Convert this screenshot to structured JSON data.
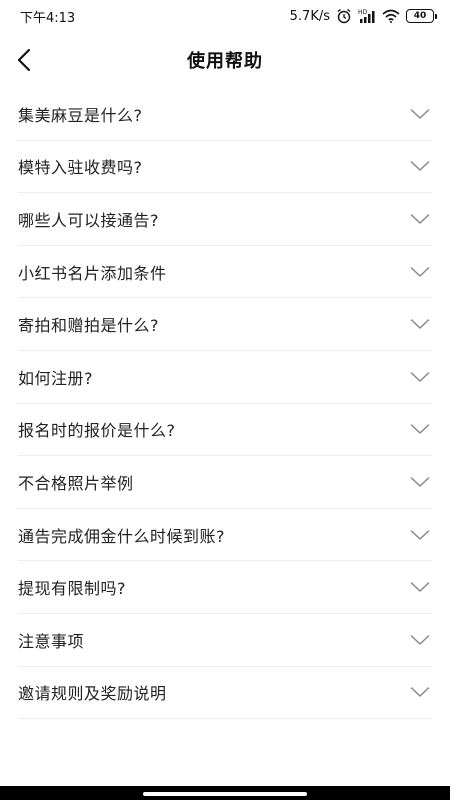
{
  "status_bar": {
    "time": "下午4:13",
    "network_speed": "5.7K/s",
    "battery": "40",
    "icons": [
      "alarm-icon",
      "hd-signal-icon",
      "wifi-icon",
      "battery-icon"
    ]
  },
  "nav": {
    "title": "使用帮助",
    "back_icon": "chevron-left-icon"
  },
  "faq": {
    "items": [
      {
        "label": "集美麻豆是什么?"
      },
      {
        "label": "模特入驻收费吗?"
      },
      {
        "label": "哪些人可以接通告?"
      },
      {
        "label": "小红书名片添加条件"
      },
      {
        "label": "寄拍和赠拍是什么?"
      },
      {
        "label": "如何注册?"
      },
      {
        "label": "报名时的报价是什么?"
      },
      {
        "label": "不合格照片举例"
      },
      {
        "label": "通告完成佣金什么时候到账?"
      },
      {
        "label": "提现有限制吗?"
      },
      {
        "label": "注意事项"
      },
      {
        "label": "邀请规则及奖励说明"
      }
    ],
    "expand_icon": "chevron-down-icon"
  },
  "colors": {
    "text": "#222222",
    "divider": "#eeeeee",
    "chevron": "#888888"
  }
}
